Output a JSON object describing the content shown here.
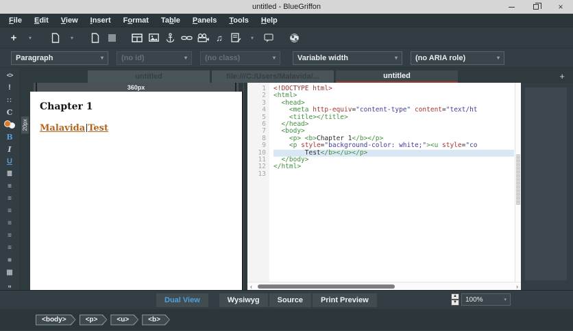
{
  "window": {
    "title": "untitled - BlueGriffon"
  },
  "menubar": {
    "items": [
      {
        "label": "File",
        "mnemonic": 0
      },
      {
        "label": "Edit",
        "mnemonic": 0
      },
      {
        "label": "View",
        "mnemonic": 0
      },
      {
        "label": "Insert",
        "mnemonic": 0
      },
      {
        "label": "Format",
        "mnemonic": 1
      },
      {
        "label": "Table",
        "mnemonic": 2
      },
      {
        "label": "Panels",
        "mnemonic": 0
      },
      {
        "label": "Tools",
        "mnemonic": 0
      },
      {
        "label": "Help",
        "mnemonic": 0
      }
    ]
  },
  "toolbar": {
    "icons": [
      {
        "name": "add-element-icon",
        "glyph": "plus"
      },
      {
        "name": "add-element-dropdown-icon",
        "glyph": "chevron"
      },
      {
        "name": "new-document-icon",
        "glyph": "doc"
      },
      {
        "name": "new-document-dropdown-icon",
        "glyph": "chevron"
      },
      {
        "name": "open-document-icon",
        "glyph": "doc"
      },
      {
        "name": "save-icon",
        "glyph": "square"
      },
      {
        "name": "insert-table-icon",
        "glyph": "table"
      },
      {
        "name": "insert-image-icon",
        "glyph": "image"
      },
      {
        "name": "insert-anchor-icon",
        "glyph": "anchor"
      },
      {
        "name": "insert-link-icon",
        "glyph": "link"
      },
      {
        "name": "insert-video-icon",
        "glyph": "video"
      },
      {
        "name": "insert-audio-icon",
        "glyph": "music"
      },
      {
        "name": "insert-form-icon",
        "glyph": "form"
      },
      {
        "name": "insert-form-dropdown-icon",
        "glyph": "chevron"
      },
      {
        "name": "insert-comment-icon",
        "glyph": "comment"
      },
      {
        "name": "browse-icon",
        "glyph": "globe"
      }
    ]
  },
  "formatbar": {
    "fields": [
      {
        "label": "Paragraph",
        "disabled": false
      },
      {
        "label": "(no id)",
        "disabled": true
      },
      {
        "label": "(no class)",
        "disabled": true
      },
      {
        "label": "Variable width",
        "disabled": false
      },
      {
        "label": "(no ARIA role)",
        "disabled": false
      }
    ]
  },
  "rail": {
    "icons": [
      {
        "name": "code-view-icon",
        "glyph": "code"
      },
      {
        "name": "emphasis-icon",
        "glyph": "bang"
      },
      {
        "name": "quotes-icon",
        "glyph": "quotes"
      },
      {
        "name": "class-style-icon",
        "glyph": "cee"
      },
      {
        "name": "color-swatch-icon",
        "glyph": "colors"
      },
      {
        "name": "bold-icon",
        "glyph": "bold"
      },
      {
        "name": "italic-icon",
        "glyph": "italic"
      },
      {
        "name": "underline-icon",
        "glyph": "underline"
      },
      {
        "name": "bullet-list-icon",
        "glyph": "ul"
      },
      {
        "name": "numbered-list-icon",
        "glyph": "ol"
      },
      {
        "name": "outdent-icon",
        "glyph": "lines"
      },
      {
        "name": "indent-icon",
        "glyph": "lines"
      },
      {
        "name": "align-left-icon",
        "glyph": "lines"
      },
      {
        "name": "align-center-icon",
        "glyph": "lines"
      },
      {
        "name": "align-right-icon",
        "glyph": "lines"
      },
      {
        "name": "block-element-icon",
        "glyph": "block"
      },
      {
        "name": "image-block-icon",
        "glyph": "grid"
      },
      {
        "name": "quote-block-icon",
        "glyph": "dquote"
      }
    ]
  },
  "tabs": {
    "items": [
      {
        "label": "untitled",
        "state": "inactive"
      },
      {
        "label": "file:///C:/Users/Malavida/...",
        "state": "inactive"
      },
      {
        "label": "untitled",
        "state": "active"
      }
    ],
    "new_tab_label": "+"
  },
  "wysiwyg": {
    "ruler_width_label": "360px",
    "ruler_margin_label": "20px",
    "heading": "Chapter 1",
    "text_before_caret": "Malavida",
    "text_after_caret": "Test"
  },
  "source": {
    "lines": [
      {
        "n": "1",
        "segs": [
          [
            "doctype",
            "<!DOCTYPE html>"
          ]
        ]
      },
      {
        "n": "2",
        "segs": [
          [
            "tag",
            "<html>"
          ]
        ]
      },
      {
        "n": "3",
        "segs": [
          [
            "plain",
            "  "
          ],
          [
            "tag",
            "<head>"
          ]
        ]
      },
      {
        "n": "4",
        "segs": [
          [
            "plain",
            "    "
          ],
          [
            "tag",
            "<meta"
          ],
          [
            "plain",
            " "
          ],
          [
            "attr",
            "http-equiv"
          ],
          [
            "plain",
            "="
          ],
          [
            "val",
            "\"content-type\""
          ],
          [
            "plain",
            " "
          ],
          [
            "attr",
            "content"
          ],
          [
            "plain",
            "="
          ],
          [
            "val",
            "\"text/ht"
          ]
        ]
      },
      {
        "n": "5",
        "segs": [
          [
            "plain",
            "    "
          ],
          [
            "tag",
            "<title></title>"
          ]
        ]
      },
      {
        "n": "6",
        "segs": [
          [
            "plain",
            "  "
          ],
          [
            "tag",
            "</head>"
          ]
        ]
      },
      {
        "n": "7",
        "segs": [
          [
            "plain",
            "  "
          ],
          [
            "tag",
            "<body>"
          ]
        ]
      },
      {
        "n": "8",
        "segs": [
          [
            "plain",
            "    "
          ],
          [
            "tag",
            "<p>"
          ],
          [
            "plain",
            " "
          ],
          [
            "tag",
            "<b>"
          ],
          [
            "plain",
            "Chapter 1"
          ],
          [
            "tag",
            "</b></p>"
          ]
        ]
      },
      {
        "n": "9",
        "segs": [
          [
            "plain",
            "    "
          ],
          [
            "tag",
            "<p "
          ],
          [
            "attr",
            "style"
          ],
          [
            "plain",
            "="
          ],
          [
            "val",
            "\"background-color: white;\""
          ],
          [
            "tag",
            "><u "
          ],
          [
            "attr",
            "style"
          ],
          [
            "plain",
            "="
          ],
          [
            "val",
            "\"co"
          ]
        ]
      },
      {
        "n": "10",
        "highlight": true,
        "segs": [
          [
            "plain",
            "        Test"
          ],
          [
            "tag",
            "</b></u></p>"
          ]
        ]
      },
      {
        "n": "11",
        "segs": [
          [
            "plain",
            "  "
          ],
          [
            "tag",
            "</body>"
          ]
        ]
      },
      {
        "n": "12",
        "segs": [
          [
            "tag",
            "</html>"
          ]
        ]
      },
      {
        "n": "13",
        "segs": []
      }
    ]
  },
  "bottom_bar": {
    "view_buttons": [
      {
        "label": "Dual View",
        "active": true
      },
      {
        "label": "Wysiwyg",
        "active": false
      },
      {
        "label": "Source",
        "active": false
      },
      {
        "label": "Print Preview",
        "active": false
      }
    ],
    "zoom_value": "100%"
  },
  "statusbar": {
    "breadcrumb": [
      "<body>",
      "<p>",
      "<u>",
      "<b>"
    ]
  }
}
